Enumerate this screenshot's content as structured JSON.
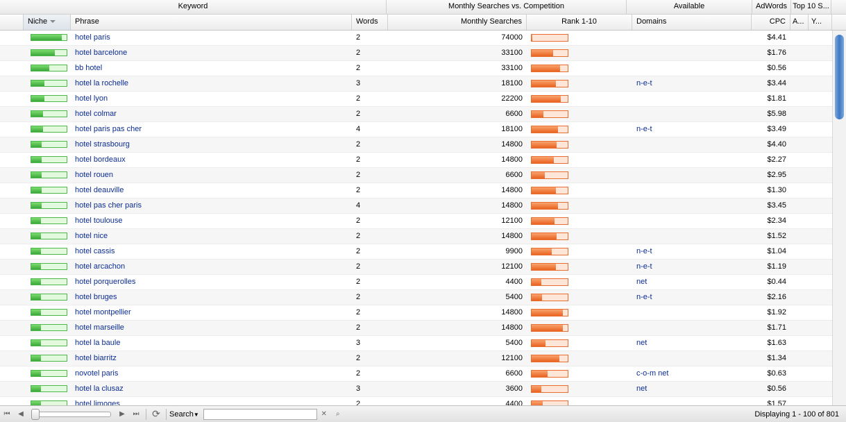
{
  "groups": {
    "keyword": "Keyword",
    "monthly_vs_competition": "Monthly Searches vs. Competition",
    "available": "Available",
    "adwords": "AdWords",
    "top10": "Top 10 S..."
  },
  "columns": {
    "niche": "Niche",
    "phrase": "Phrase",
    "words": "Words",
    "monthly": "Monthly Searches",
    "rank": "Rank 1-10",
    "domains": "Domains",
    "cpc": "CPC",
    "a": "A...",
    "y": "Y..."
  },
  "rows": [
    {
      "phrase": "hotel paris",
      "words": "2",
      "monthly": "74000",
      "domains": "",
      "cpc": "$4.41",
      "niche": 0.86,
      "rank": 0.02
    },
    {
      "phrase": "hotel barcelone",
      "words": "2",
      "monthly": "33100",
      "domains": "",
      "cpc": "$1.76",
      "niche": 0.66,
      "rank": 0.6
    },
    {
      "phrase": "bb hotel",
      "words": "2",
      "monthly": "33100",
      "domains": "",
      "cpc": "$0.56",
      "niche": 0.5,
      "rank": 0.78
    },
    {
      "phrase": "hotel la rochelle",
      "words": "3",
      "monthly": "18100",
      "domains": "n-e-t",
      "cpc": "$3.44",
      "niche": 0.38,
      "rank": 0.68
    },
    {
      "phrase": "hotel lyon",
      "words": "2",
      "monthly": "22200",
      "domains": "",
      "cpc": "$1.81",
      "niche": 0.38,
      "rank": 0.8
    },
    {
      "phrase": "hotel colmar",
      "words": "2",
      "monthly": "6600",
      "domains": "",
      "cpc": "$5.98",
      "niche": 0.33,
      "rank": 0.32
    },
    {
      "phrase": "hotel paris pas cher",
      "words": "4",
      "monthly": "18100",
      "domains": "n-e-t",
      "cpc": "$3.49",
      "niche": 0.33,
      "rank": 0.74
    },
    {
      "phrase": "hotel strasbourg",
      "words": "2",
      "monthly": "14800",
      "domains": "",
      "cpc": "$4.40",
      "niche": 0.3,
      "rank": 0.7
    },
    {
      "phrase": "hotel bordeaux",
      "words": "2",
      "monthly": "14800",
      "domains": "",
      "cpc": "$2.27",
      "niche": 0.3,
      "rank": 0.62
    },
    {
      "phrase": "hotel rouen",
      "words": "2",
      "monthly": "6600",
      "domains": "",
      "cpc": "$2.95",
      "niche": 0.3,
      "rank": 0.36
    },
    {
      "phrase": "hotel deauville",
      "words": "2",
      "monthly": "14800",
      "domains": "",
      "cpc": "$1.30",
      "niche": 0.3,
      "rank": 0.68
    },
    {
      "phrase": "hotel pas cher paris",
      "words": "4",
      "monthly": "14800",
      "domains": "",
      "cpc": "$3.45",
      "niche": 0.3,
      "rank": 0.74
    },
    {
      "phrase": "hotel toulouse",
      "words": "2",
      "monthly": "12100",
      "domains": "",
      "cpc": "$2.34",
      "niche": 0.28,
      "rank": 0.64
    },
    {
      "phrase": "hotel nice",
      "words": "2",
      "monthly": "14800",
      "domains": "",
      "cpc": "$1.52",
      "niche": 0.28,
      "rank": 0.7
    },
    {
      "phrase": "hotel cassis",
      "words": "2",
      "monthly": "9900",
      "domains": "n-e-t",
      "cpc": "$1.04",
      "niche": 0.28,
      "rank": 0.56
    },
    {
      "phrase": "hotel arcachon",
      "words": "2",
      "monthly": "12100",
      "domains": "n-e-t",
      "cpc": "$1.19",
      "niche": 0.28,
      "rank": 0.68
    },
    {
      "phrase": "hotel porquerolles",
      "words": "2",
      "monthly": "4400",
      "domains": "net",
      "cpc": "$0.44",
      "niche": 0.28,
      "rank": 0.26
    },
    {
      "phrase": "hotel bruges",
      "words": "2",
      "monthly": "5400",
      "domains": "n-e-t",
      "cpc": "$2.16",
      "niche": 0.28,
      "rank": 0.28
    },
    {
      "phrase": "hotel montpellier",
      "words": "2",
      "monthly": "14800",
      "domains": "",
      "cpc": "$1.92",
      "niche": 0.28,
      "rank": 0.86
    },
    {
      "phrase": "hotel marseille",
      "words": "2",
      "monthly": "14800",
      "domains": "",
      "cpc": "$1.71",
      "niche": 0.28,
      "rank": 0.86
    },
    {
      "phrase": "hotel la baule",
      "words": "3",
      "monthly": "5400",
      "domains": "net",
      "cpc": "$1.63",
      "niche": 0.28,
      "rank": 0.38
    },
    {
      "phrase": "hotel biarritz",
      "words": "2",
      "monthly": "12100",
      "domains": "",
      "cpc": "$1.34",
      "niche": 0.28,
      "rank": 0.76
    },
    {
      "phrase": "novotel paris",
      "words": "2",
      "monthly": "6600",
      "domains": "c-o-m net",
      "cpc": "$0.63",
      "niche": 0.28,
      "rank": 0.44
    },
    {
      "phrase": "hotel la clusaz",
      "words": "3",
      "monthly": "3600",
      "domains": "net",
      "cpc": "$0.56",
      "niche": 0.28,
      "rank": 0.26
    },
    {
      "phrase": "hotel limoges",
      "words": "2",
      "monthly": "4400",
      "domains": "",
      "cpc": "$1.57",
      "niche": 0.28,
      "rank": 0.3
    }
  ],
  "footer": {
    "search_label": "Search",
    "search_value": "",
    "status": "Displaying 1 - 100 of 801"
  },
  "colors": {
    "niche_bar": "#3ca83a",
    "rank_bar": "#e96321",
    "link": "#0b2c93"
  }
}
